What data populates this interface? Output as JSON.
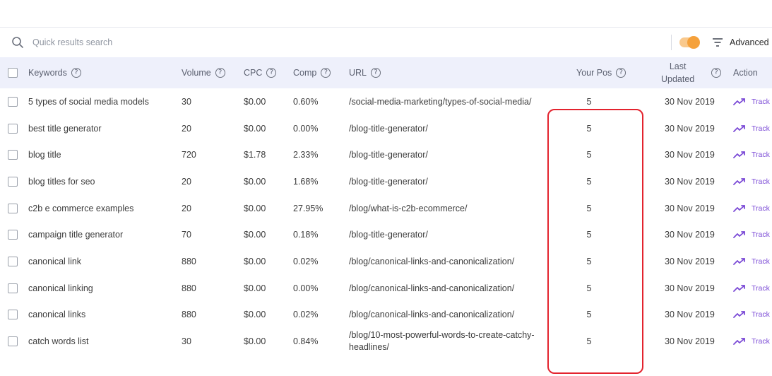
{
  "search": {
    "placeholder": "Quick results search"
  },
  "toolbar": {
    "advanced_label": "Advanced",
    "toggle_color": "#f5a13b"
  },
  "table": {
    "columns": {
      "keywords": "Keywords",
      "volume": "Volume",
      "cpc": "CPC",
      "comp": "Comp",
      "url": "URL",
      "your_pos": "Your Pos",
      "last": "Last",
      "updated": "Updated",
      "action": "Action"
    },
    "help_glyph": "?",
    "action_label": "Track",
    "rows": [
      {
        "keyword": "5 types of social media models",
        "volume": "30",
        "cpc": "$0.00",
        "comp": "0.60%",
        "url": "/social-media-marketing/types-of-social-media/",
        "pos": "5",
        "date": "30 Nov 2019"
      },
      {
        "keyword": "best title generator",
        "volume": "20",
        "cpc": "$0.00",
        "comp": "0.00%",
        "url": "/blog-title-generator/",
        "pos": "5",
        "date": "30 Nov 2019"
      },
      {
        "keyword": "blog title",
        "volume": "720",
        "cpc": "$1.78",
        "comp": "2.33%",
        "url": "/blog-title-generator/",
        "pos": "5",
        "date": "30 Nov 2019"
      },
      {
        "keyword": "blog titles for seo",
        "volume": "20",
        "cpc": "$0.00",
        "comp": "1.68%",
        "url": "/blog-title-generator/",
        "pos": "5",
        "date": "30 Nov 2019"
      },
      {
        "keyword": "c2b e commerce examples",
        "volume": "20",
        "cpc": "$0.00",
        "comp": "27.95%",
        "url": "/blog/what-is-c2b-ecommerce/",
        "pos": "5",
        "date": "30 Nov 2019"
      },
      {
        "keyword": "campaign title generator",
        "volume": "70",
        "cpc": "$0.00",
        "comp": "0.18%",
        "url": "/blog-title-generator/",
        "pos": "5",
        "date": "30 Nov 2019"
      },
      {
        "keyword": "canonical link",
        "volume": "880",
        "cpc": "$0.00",
        "comp": "0.02%",
        "url": "/blog/canonical-links-and-canonicalization/",
        "pos": "5",
        "date": "30 Nov 2019"
      },
      {
        "keyword": "canonical linking",
        "volume": "880",
        "cpc": "$0.00",
        "comp": "0.00%",
        "url": "/blog/canonical-links-and-canonicalization/",
        "pos": "5",
        "date": "30 Nov 2019"
      },
      {
        "keyword": "canonical links",
        "volume": "880",
        "cpc": "$0.00",
        "comp": "0.02%",
        "url": "/blog/canonical-links-and-canonicalization/",
        "pos": "5",
        "date": "30 Nov 2019"
      },
      {
        "keyword": "catch words list",
        "volume": "30",
        "cpc": "$0.00",
        "comp": "0.84%",
        "url": "/blog/10-most-powerful-words-to-create-catchy-headlines/",
        "pos": "5",
        "date": "30 Nov 2019"
      }
    ]
  },
  "colors": {
    "header_bg": "#eef0fb",
    "track": "#7b4ad6",
    "highlight": "#e3232e"
  }
}
